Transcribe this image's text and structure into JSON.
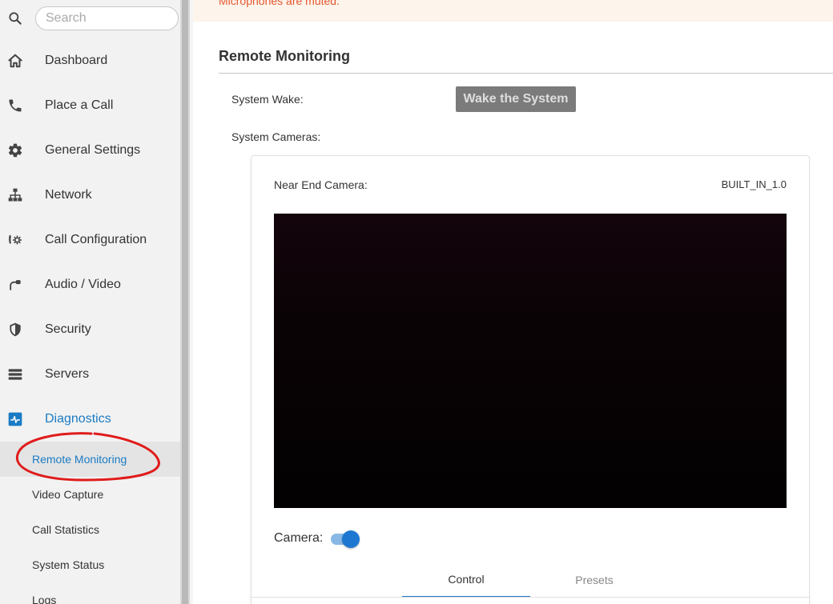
{
  "search": {
    "placeholder": "Search"
  },
  "sidebar": {
    "items": [
      {
        "label": "Dashboard",
        "icon": "home-icon"
      },
      {
        "label": "Place a Call",
        "icon": "phone-icon"
      },
      {
        "label": "General Settings",
        "icon": "gear-icon"
      },
      {
        "label": "Network",
        "icon": "network-icon"
      },
      {
        "label": "Call Configuration",
        "icon": "call-config-icon"
      },
      {
        "label": "Audio / Video",
        "icon": "audio-video-icon"
      },
      {
        "label": "Security",
        "icon": "shield-icon"
      },
      {
        "label": "Servers",
        "icon": "servers-icon"
      },
      {
        "label": "Diagnostics",
        "icon": "diagnostics-icon",
        "active": true
      }
    ],
    "subitems": [
      {
        "label": "Remote Monitoring",
        "selected": true
      },
      {
        "label": "Video Capture"
      },
      {
        "label": "Call Statistics"
      },
      {
        "label": "System Status"
      },
      {
        "label": "Logs"
      }
    ]
  },
  "alert": {
    "text": "Microphones are muted."
  },
  "main": {
    "title": "Remote Monitoring",
    "system_wake_label": "System Wake:",
    "wake_button": "Wake the System",
    "system_cameras_label": "System Cameras:",
    "camera": {
      "label": "Near End Camera:",
      "value": "BUILT_IN_1.0",
      "toggle_label": "Camera:",
      "toggle_on": true
    },
    "tabs": [
      {
        "label": "Control",
        "active": true
      },
      {
        "label": "Presets",
        "active": false
      }
    ]
  },
  "colors": {
    "accent": "#1a7bc4",
    "alert_text": "#e4572e",
    "alert_bg": "#fdf4ec",
    "sidebar_bg": "#f2f2f2",
    "annotation": "#e01b1b"
  }
}
